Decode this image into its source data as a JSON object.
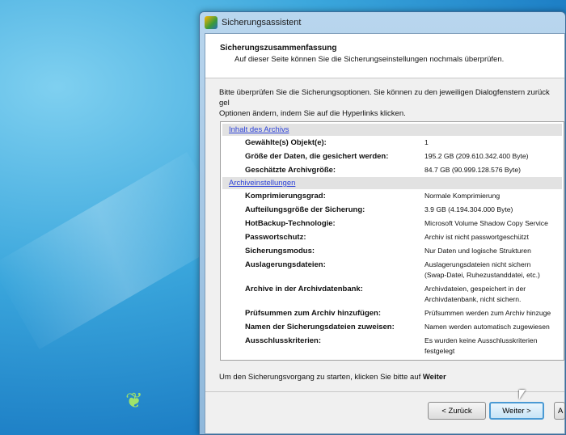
{
  "window": {
    "title": "Sicherungsassistent"
  },
  "header": {
    "title": "Sicherungszusammenfassung",
    "subtitle": "Auf dieser Seite können Sie die Sicherungseinstellungen nochmals überprüfen."
  },
  "intro": [
    "Bitte überprüfen Sie die Sicherungsoptionen. Sie können zu den jeweiligen Dialogfenstern zurück gel",
    "Optionen ändern, indem Sie auf die Hyperlinks klicken."
  ],
  "sections": [
    {
      "link": "Inhalt des Archivs",
      "rows": [
        {
          "label": "Gewählte(s) Objekt(e):",
          "value": [
            "1"
          ]
        },
        {
          "label": "Größe der Daten, die gesichert werden:",
          "value": [
            "195.2 GB (209.610.342.400 Byte)"
          ]
        },
        {
          "label": "Geschätzte Archivgröße:",
          "value": [
            "84.7 GB (90.999.128.576 Byte)"
          ]
        }
      ]
    },
    {
      "link": "Archiveinstellungen",
      "rows": [
        {
          "label": "Komprimierungsgrad:",
          "value": [
            "Normale Komprimierung"
          ]
        },
        {
          "label": "Aufteilungsgröße der Sicherung:",
          "value": [
            "3.9 GB (4.194.304.000 Byte)"
          ]
        },
        {
          "label": "HotBackup-Technologie:",
          "value": [
            "Microsoft Volume Shadow Copy Service"
          ]
        },
        {
          "label": "Passwortschutz:",
          "value": [
            "Archiv ist nicht passwortgeschützt"
          ]
        },
        {
          "label": "Sicherungsmodus:",
          "value": [
            "Nur Daten und logische Strukturen"
          ]
        },
        {
          "label": "Auslagerungsdateien:",
          "value": [
            "Auslagerungsdateien nicht sichern",
            "(Swap-Datei, Ruhezustanddatei, etc.)"
          ]
        },
        {
          "label": "Archive in der Archivdatenbank:",
          "value": [
            "Archivdateien, gespeichert in der",
            "Archivdatenbank, nicht sichern."
          ]
        },
        {
          "label": "Prüfsummen zum Archiv hinzufügen:",
          "value": [
            "Prüfsummen werden zum Archiv hinzuge"
          ]
        },
        {
          "label": "Namen der Sicherungsdateien zuweisen:",
          "value": [
            "Namen werden automatisch zugewiesen"
          ]
        },
        {
          "label": "Ausschlusskriterien:",
          "value": [
            "Es wurden keine Ausschlusskriterien",
            "festgelegt"
          ]
        }
      ]
    }
  ],
  "footer": {
    "text": "Um den Sicherungsvorgang zu starten, klicken Sie bitte auf ",
    "bold": "Weiter"
  },
  "buttons": {
    "back": "< Zurück",
    "next": "Weiter >",
    "third": "A"
  }
}
